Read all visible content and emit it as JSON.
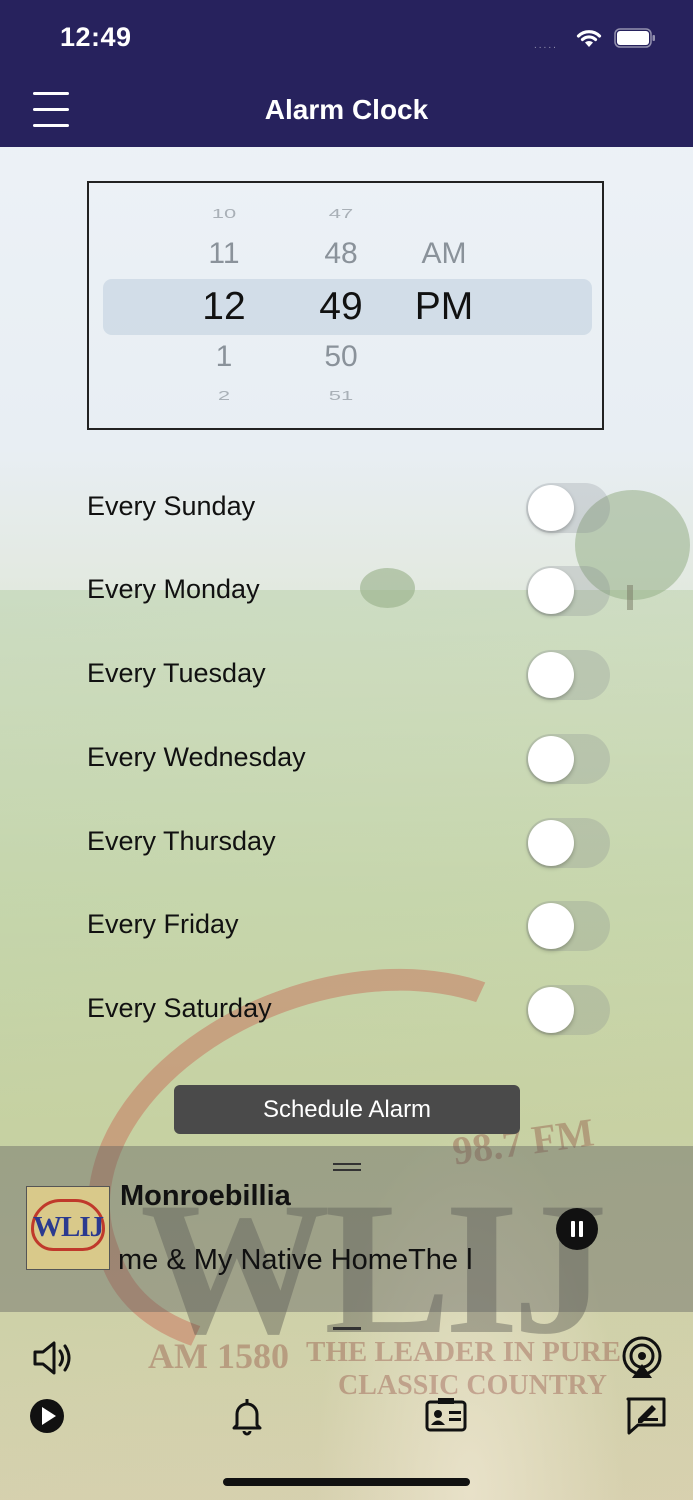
{
  "status_bar": {
    "time": "12:49",
    "signal": "....."
  },
  "nav": {
    "title": "Alarm Clock"
  },
  "time_picker": {
    "hours": [
      "10",
      "11",
      "12",
      "1",
      "2"
    ],
    "minutes": [
      "47",
      "48",
      "49",
      "50",
      "51"
    ],
    "ampm": [
      "",
      "AM",
      "PM",
      "",
      ""
    ],
    "selected": {
      "hour": "12",
      "minute": "49",
      "period": "PM"
    }
  },
  "days": [
    {
      "label": "Every Sunday",
      "enabled": false
    },
    {
      "label": "Every Monday",
      "enabled": false
    },
    {
      "label": "Every Tuesday",
      "enabled": false
    },
    {
      "label": "Every Wednesday",
      "enabled": false
    },
    {
      "label": "Every Thursday",
      "enabled": false
    },
    {
      "label": "Every Friday",
      "enabled": false
    },
    {
      "label": "Every Saturday",
      "enabled": false
    }
  ],
  "schedule_button": "Schedule Alarm",
  "player": {
    "title": "Monroebillia",
    "marquee": "me & My Native HomeThe l",
    "album_logo": "WLIJ",
    "state": "playing"
  },
  "watermark": {
    "freq": "98.7 FM",
    "call": "WLIJ",
    "am": "AM 1580",
    "slogan_1": "THE LEADER IN PURE",
    "slogan_2": "CLASSIC COUNTRY"
  },
  "toolbar": {
    "icons": [
      "volume-icon",
      "airplay-icon",
      "play-icon",
      "bell-icon",
      "contact-card-icon",
      "message-icon"
    ]
  },
  "colors": {
    "nav_bg": "#27225d",
    "button_bg": "#4a4a4a"
  }
}
